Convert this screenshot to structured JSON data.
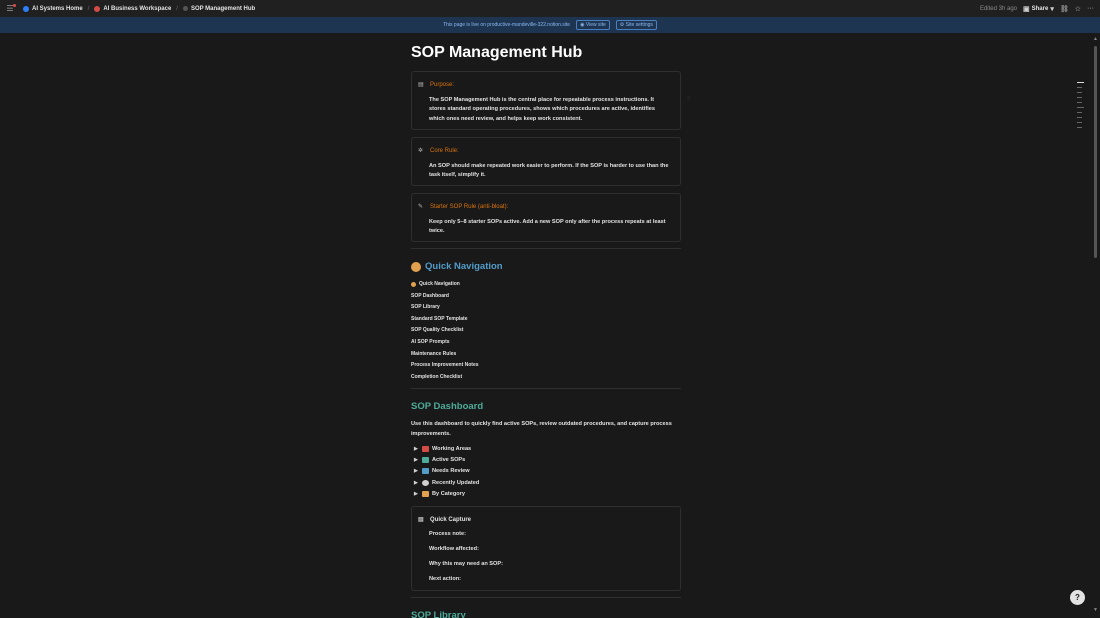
{
  "topbar": {
    "breadcrumbs": [
      {
        "label": "AI Systems Home",
        "icon": "blue-circle-icon"
      },
      {
        "label": "AI Business Workspace",
        "icon": "red-circle-icon"
      },
      {
        "label": "SOP Management Hub",
        "icon": "page-icon"
      }
    ],
    "edited": "Edited 3h ago",
    "share_label": "Share"
  },
  "banner": {
    "text": "This page is live on productive-mandeville-322.notion.site",
    "view_site": "View site",
    "site_settings": "Site settings"
  },
  "page": {
    "title": "SOP Management Hub",
    "callouts": [
      {
        "heading": "Purpose:",
        "icon": "page-icon",
        "body": "The SOP Management Hub is the central place for repeatable process instructions. It stores standard operating procedures, shows which procedures are active, identifies which ones need review, and helps keep work consistent."
      },
      {
        "heading": "Core Rule:",
        "icon": "gear-icon",
        "body": "An SOP should make repeated work easier to perform. If the SOP is harder to use than the task itself, simplify it."
      },
      {
        "heading": "Starter SOP Rule (anti-bloat):",
        "icon": "pencil-icon",
        "body": "Keep only 5–8 starter SOPs active. Add a new SOP only after the process repeats at least twice."
      }
    ],
    "quick_nav_heading": "Quick Navigation",
    "quick_nav_items": [
      "Quick Navigation",
      "SOP Dashboard",
      "SOP Library",
      "Standard SOP Template",
      "SOP Quality Checklist",
      "AI SOP Prompts",
      "Maintenance Rules",
      "Process Improvement Notes",
      "Completion Checklist"
    ],
    "dashboard_heading": "SOP Dashboard",
    "dashboard_text": "Use this dashboard to quickly find active SOPs, review outdated procedures, and capture process improvements.",
    "toggles": [
      {
        "label": "Working Areas",
        "icon": "pin-icon",
        "color": "#d44c47"
      },
      {
        "label": "Active SOPs",
        "icon": "check-icon",
        "color": "#4dab9a"
      },
      {
        "label": "Needs Review",
        "icon": "warning-icon",
        "color": "#529cca"
      },
      {
        "label": "Recently Updated",
        "icon": "clock-icon",
        "color": "#cfcfcf"
      },
      {
        "label": "By Category",
        "icon": "folder-icon",
        "color": "#e2a14e"
      }
    ],
    "quick_capture": {
      "heading": "Quick Capture",
      "items": [
        "Process note:",
        "Workflow affected:",
        "Why this may need an SOP:",
        "Next action:"
      ]
    },
    "library_heading": "SOP Library"
  },
  "help_label": "?"
}
